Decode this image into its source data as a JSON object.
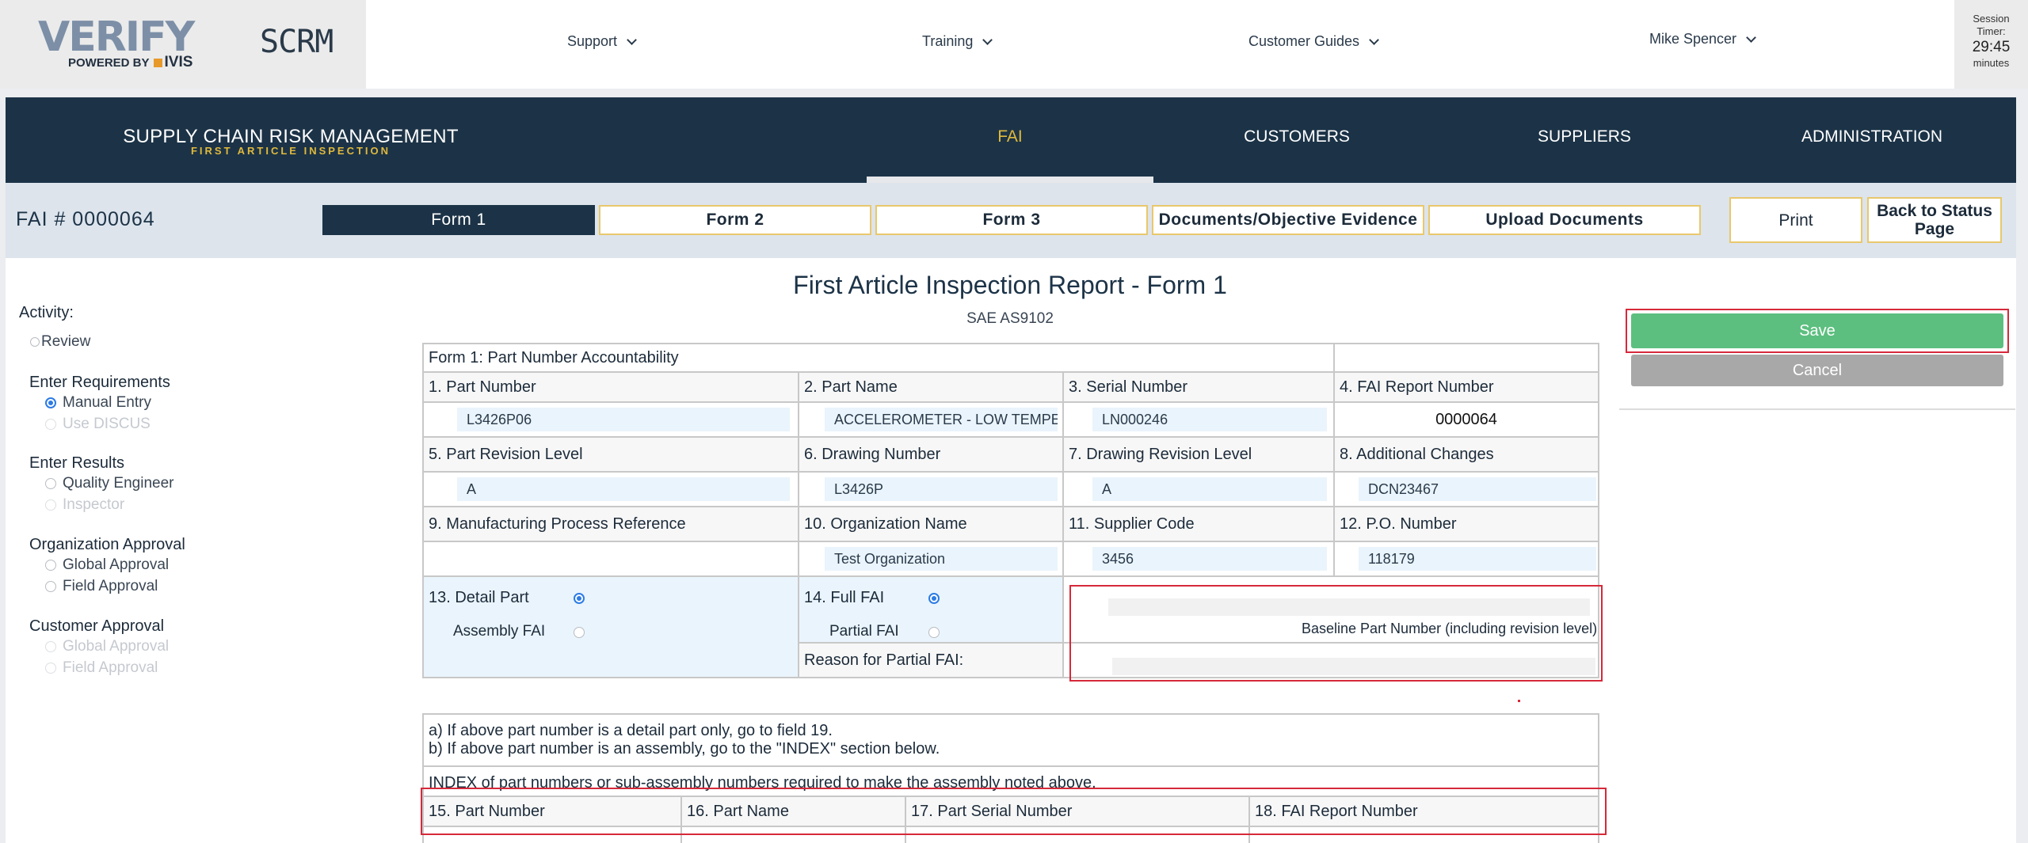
{
  "header": {
    "logo": {
      "word": "VERIFY",
      "powered_by": "POWERED BY",
      "ivis": "IVIS"
    },
    "app_name": "SCRM",
    "nav": [
      "Support",
      "Training",
      "Customer Guides"
    ],
    "user": "Mike Spencer",
    "timer": {
      "label": "Session Timer:",
      "value": "29:45",
      "unit": "minutes"
    }
  },
  "main_nav": {
    "title": "SUPPLY CHAIN RISK MANAGEMENT",
    "subtitle": "FIRST ARTICLE INSPECTION",
    "items": [
      "FAI",
      "CUSTOMERS",
      "SUPPLIERS",
      "ADMINISTRATION"
    ],
    "active": "FAI"
  },
  "tabbar": {
    "fai_number": "FAI # 0000064",
    "tabs": [
      "Form 1",
      "Form 2",
      "Form 3",
      "Documents/Objective Evidence",
      "Upload Documents"
    ],
    "print": "Print",
    "back": "Back to Status Page"
  },
  "sidebar": {
    "activity_label": "Activity:",
    "review": "Review",
    "groups": [
      {
        "title": "Enter Requirements",
        "options": [
          "Manual Entry",
          "Use DISCUS"
        ]
      },
      {
        "title": "Enter Results",
        "options": [
          "Quality Engineer",
          "Inspector"
        ]
      },
      {
        "title": "Organization Approval",
        "options": [
          "Global Approval",
          "Field Approval"
        ]
      },
      {
        "title": "Customer Approval",
        "options": [
          "Global Approval",
          "Field Approval"
        ]
      }
    ]
  },
  "report": {
    "title": "First Article Inspection Report - Form 1",
    "subtitle": "SAE AS9102",
    "section_title": "Form 1: Part Number Accountability",
    "labels": {
      "f1": "1. Part Number",
      "f2": "2. Part Name",
      "f3": "3. Serial Number",
      "f4": "4. FAI Report Number",
      "f5": "5. Part Revision Level",
      "f6": "6. Drawing Number",
      "f7": "7. Drawing Revision Level",
      "f8": "8. Additional Changes",
      "f9": "9. Manufacturing Process Reference",
      "f10": "10. Organization Name",
      "f11": "11. Supplier Code",
      "f12": "12. P.O. Number",
      "f13": "13. Detail Part",
      "f13b": "Assembly FAI",
      "f14": "14. Full FAI",
      "f14b": "Partial FAI",
      "baseline": "Baseline Part Number (including revision level)",
      "reason": "Reason for Partial FAI:"
    },
    "values": {
      "part_number": "L3426P06",
      "part_name": "ACCELEROMETER - LOW TEMPE",
      "serial_number": "LN000246",
      "fai_report_number": "0000064",
      "part_revision": "A",
      "drawing_number": "L3426P",
      "drawing_revision": "A",
      "additional_changes": "DCN23467",
      "org_name": "Test Organization",
      "supplier_code": "3456",
      "po_number": "118179"
    },
    "instructions": {
      "a": "a) If above part number is a detail part only, go to field 19.",
      "b": "b) If above part number is an assembly, go to the \"INDEX\" section below."
    },
    "index_text": "INDEX of part numbers or sub-assembly numbers required to make the assembly noted above.",
    "index_headers": [
      "15. Part Number",
      "16. Part Name",
      "17. Part Serial Number",
      "18. FAI Report Number"
    ]
  },
  "actions": {
    "save": "Save",
    "cancel": "Cancel"
  },
  "colors": {
    "navy": "#1c3347",
    "gold": "#e0b93c",
    "save": "#5cbf7f",
    "cancel": "#a8a8a8",
    "highlight": "#d6293a"
  }
}
